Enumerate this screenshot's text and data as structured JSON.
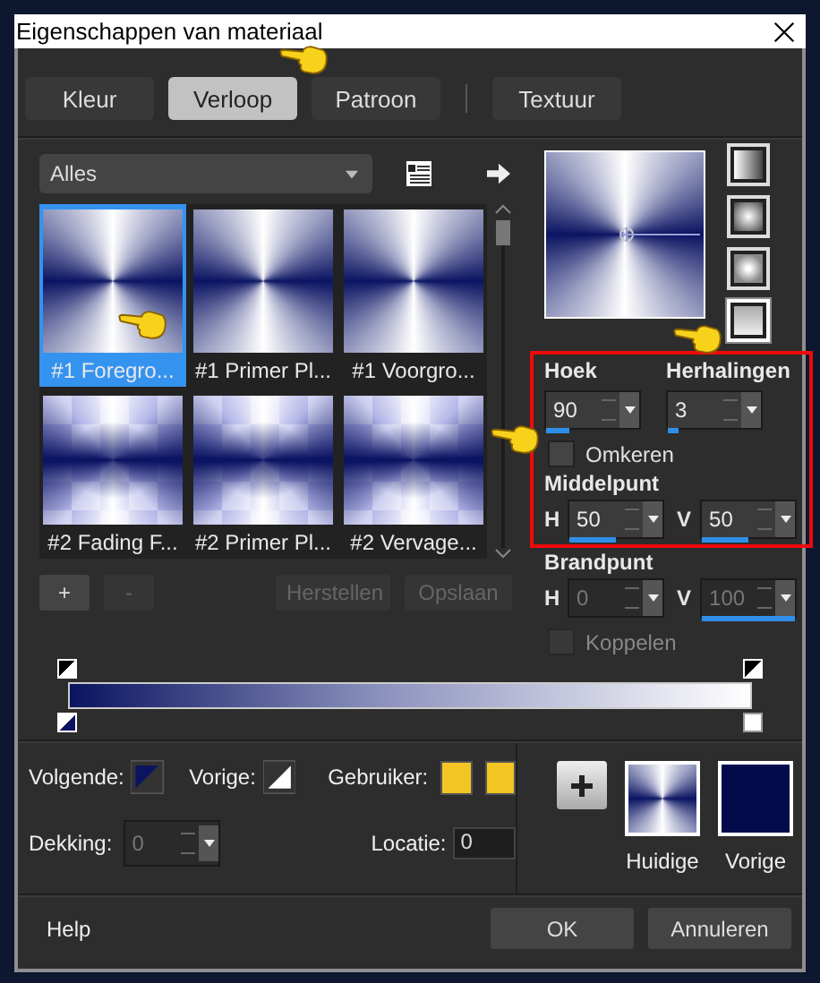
{
  "window": {
    "title": "Eigenschappen van materiaal"
  },
  "tabs": [
    {
      "label": "Kleur",
      "selected": false
    },
    {
      "label": "Verloop",
      "selected": true
    },
    {
      "label": "Patroon",
      "selected": false
    },
    {
      "label": "Textuur",
      "selected": false
    }
  ],
  "category": "Alles",
  "thumbnails": [
    {
      "label": "#1 Foregro...",
      "selected": true,
      "kind": "plain"
    },
    {
      "label": "#1 Primer Pl...",
      "selected": false,
      "kind": "plain"
    },
    {
      "label": "#1 Voorgro...",
      "selected": false,
      "kind": "plain"
    },
    {
      "label": "#2 Fading F...",
      "selected": false,
      "kind": "fading"
    },
    {
      "label": "#2 Primer Pl...",
      "selected": false,
      "kind": "fading"
    },
    {
      "label": "#2 Vervage...",
      "selected": false,
      "kind": "fading"
    }
  ],
  "styles": [
    {
      "selected": false
    },
    {
      "selected": false
    },
    {
      "selected": false
    },
    {
      "selected": true
    }
  ],
  "list_buttons": [
    {
      "label": "+",
      "disabled": false
    },
    {
      "label": "-",
      "disabled": true
    },
    {
      "label": "Herstellen",
      "disabled": true
    },
    {
      "label": "Opslaan",
      "disabled": true
    }
  ],
  "params": {
    "angle": {
      "label": "Hoek",
      "value": "90",
      "level": 0.25
    },
    "repeats": {
      "label": "Herhalingen",
      "value": "3",
      "level": 0.12
    },
    "invert": {
      "label": "Omkeren",
      "checked": false,
      "disabled": false
    },
    "midpoint": {
      "label": "Middelpunt",
      "h_label": "H",
      "h": {
        "value": "50",
        "level": 0.5
      },
      "v_label": "V",
      "v": {
        "value": "50",
        "level": 0.5
      }
    },
    "focal": {
      "label": "Brandpunt",
      "disabled": true,
      "h_label": "H",
      "h": {
        "value": "0"
      },
      "v_label": "V",
      "v": {
        "value": "100",
        "level": 1
      }
    },
    "link": {
      "label": "Koppelen",
      "checked": false,
      "disabled": true
    }
  },
  "colors": {
    "next_label": "Volgende:",
    "prev_label": "Vorige:",
    "user_label": "Gebruiker:",
    "user_swatches": [
      {
        "color": "#f2c523"
      },
      {
        "color": "#f2c523"
      }
    ],
    "opacity_label": "Dekking:",
    "opacity": "0",
    "opacity_disabled": true,
    "location_label": "Locatie:",
    "location": "0"
  },
  "swatches": [
    {
      "label": "Huidige",
      "kind": "gradient"
    },
    {
      "label": "Vorige",
      "kind": "solid",
      "color": "#030b4c"
    }
  ],
  "footer": {
    "help": "Help",
    "ok": "OK",
    "cancel": "Annuleren"
  }
}
